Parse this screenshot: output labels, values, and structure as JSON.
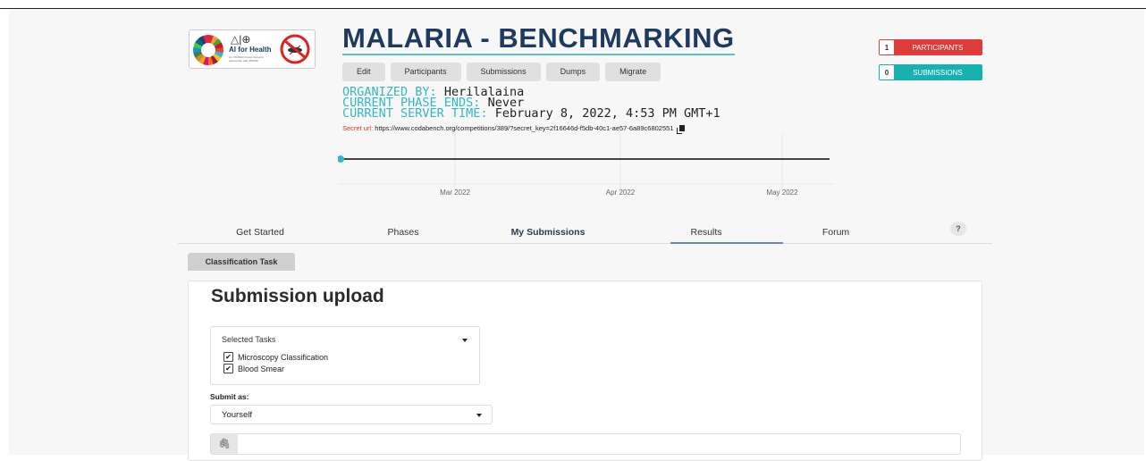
{
  "competition": {
    "title": "MALARIA - BENCHMARKING",
    "logo": {
      "icon": "sdg-wheel-icon",
      "symbols": "△|⊕",
      "text": "AI for Health",
      "small": "An ITU/WHO Focus Group in partnership with UNICEF"
    },
    "buttons": [
      "Edit",
      "Participants",
      "Submissions",
      "Dumps",
      "Migrate"
    ],
    "organized_by_label": "ORGANIZED BY:",
    "organized_by": "Herilalaina",
    "phase_ends_label": "CURRENT PHASE ENDS:",
    "phase_ends": "Never",
    "server_time_label": "CURRENT SERVER TIME:",
    "server_time": "February 8, 2022, 4:53 PM GMT+1",
    "secret_label": "Secret url:",
    "secret_url": "https://www.codabench.org/competitions/389/?secret_key=2f16646d-f5db-40c1-ae57-6a89c6802551"
  },
  "counters": {
    "participants_count": "1",
    "participants_label": "PARTICIPANTS",
    "submissions_count": "0",
    "submissions_label": "SUBMISSIONS"
  },
  "timeline": {
    "ticks": [
      "Mar 2022",
      "Apr 2022",
      "May 2022"
    ],
    "colors": {
      "start_dot": "#35b8c5",
      "line": "#444444"
    }
  },
  "tabs": [
    "Get Started",
    "Phases",
    "My Submissions",
    "Results",
    "Forum"
  ],
  "active_tab": "My Submissions",
  "help_label": "?",
  "task_tab": "Classification Task",
  "upload": {
    "heading": "Submission upload",
    "selected_tasks_label": "Selected Tasks",
    "tasks": [
      "Microscopy Classification",
      "Blood Smear"
    ],
    "submit_as_label": "Submit as:",
    "submit_as_value": "Yourself"
  }
}
